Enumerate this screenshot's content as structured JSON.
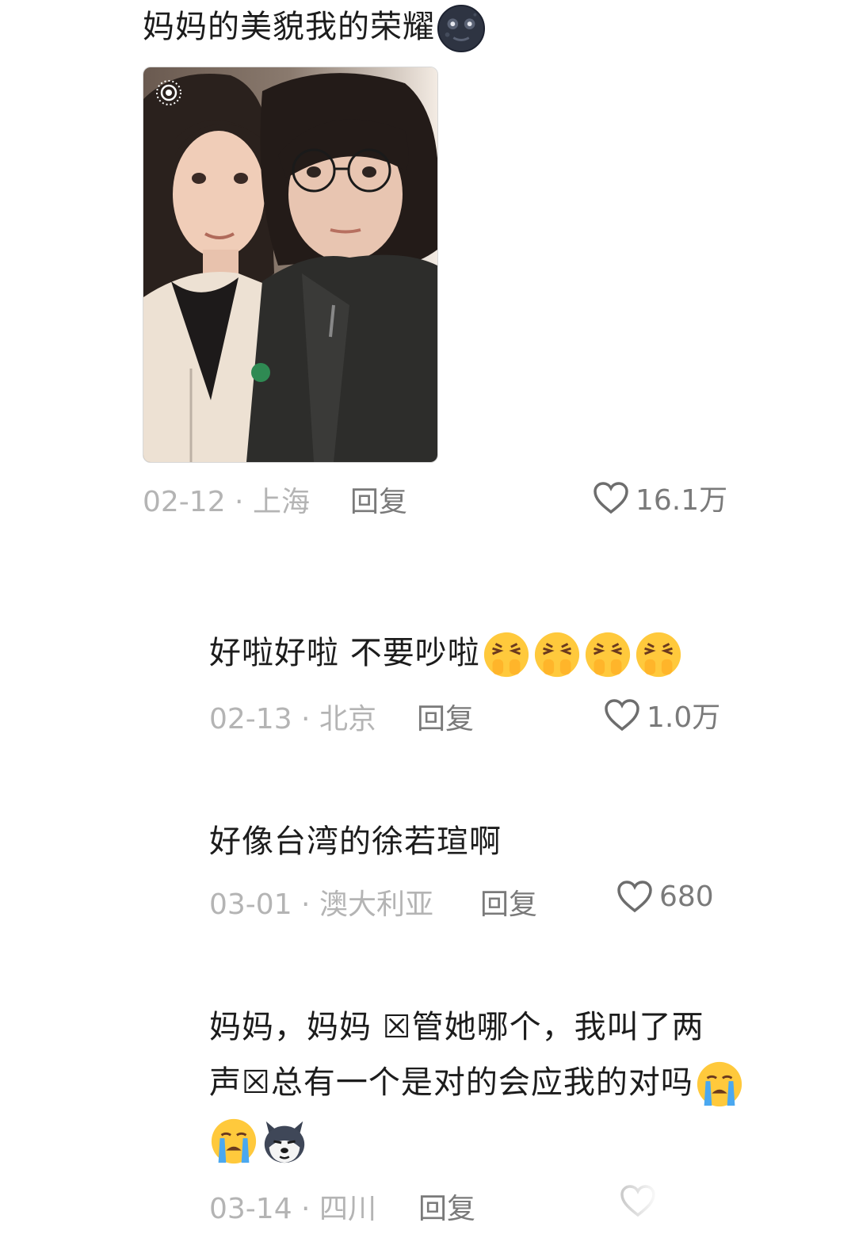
{
  "comments": [
    {
      "text": "妈妈的美貌我的荣耀",
      "date_location": "02-12 · 上海",
      "reply_label": "回复",
      "likes": "16.1万",
      "emoji": [
        "new-moon-face"
      ],
      "has_photo": true
    },
    {
      "text": "好啦好啦 不要吵啦",
      "date_location": "02-13 · 北京",
      "reply_label": "回复",
      "likes": "1.0万",
      "emoji": [
        "persevering-face",
        "persevering-face",
        "persevering-face",
        "persevering-face"
      ]
    },
    {
      "text": "好像台湾的徐若瑄啊",
      "date_location": "03-01 · 澳大利亚",
      "reply_label": "回复",
      "likes": "680"
    },
    {
      "text_line1": "妈妈，妈妈 ☒管她哪个，我叫了两",
      "text_line2": "声☒总有一个是对的会应我的对吗",
      "date_location": "03-14 · 四川",
      "reply_label": "回复",
      "emoji": [
        "loudly-crying-face",
        "loudly-crying-face",
        "husky-dog-face"
      ]
    }
  ],
  "colors": {
    "text": "#1c1c1c",
    "meta": "#b4b4b4",
    "action": "#7a7a7a",
    "emoji_yellow": "#ffc93c",
    "tear_blue": "#4aa8f0"
  }
}
